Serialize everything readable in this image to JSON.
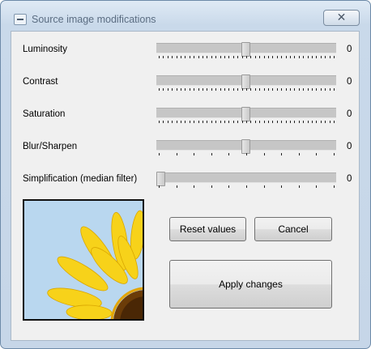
{
  "window": {
    "title": "Source image modifications",
    "close_glyph": "✕"
  },
  "sliders": [
    {
      "label": "Luminosity",
      "value": "0",
      "position": 0.5,
      "tick_count": 41
    },
    {
      "label": "Contrast",
      "value": "0",
      "position": 0.5,
      "tick_count": 41
    },
    {
      "label": "Saturation",
      "value": "0",
      "position": 0.5,
      "tick_count": 41
    },
    {
      "label": "Blur/Sharpen",
      "value": "0",
      "position": 0.5,
      "tick_count": 11
    },
    {
      "label": "Simplification (median filter)",
      "value": "0",
      "position": 0.0,
      "tick_count": 11
    }
  ],
  "buttons": {
    "reset": "Reset values",
    "cancel": "Cancel",
    "apply": "Apply changes"
  },
  "preview": {
    "subject": "sunflower petals against blue sky",
    "sky_color": "#b9d7ef",
    "petal_color": "#f7d21a"
  }
}
